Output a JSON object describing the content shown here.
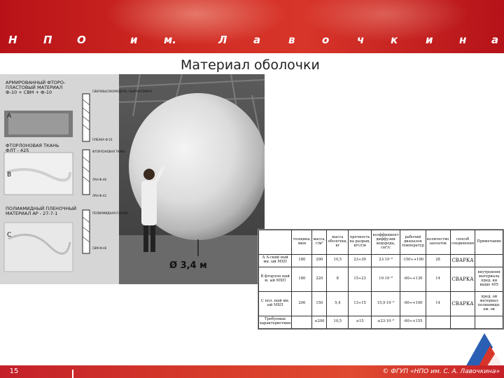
{
  "header": {
    "letters": [
      "Н",
      "П",
      "О",
      "и",
      "м.",
      "Л",
      "а",
      "в",
      "о",
      "ч",
      "к",
      "и",
      "н",
      "а"
    ],
    "background_color": "#cf2a22"
  },
  "title": "Материал оболочки",
  "photo": {
    "left_labels": {
      "material_a": "АРМИРОВАННЫЙ ФТОРО-\nПЛАСТОВЫЙ МАТЕРИАЛ\nФ-10 + СВМ + Ф-10",
      "letter_a": "А",
      "material_b": "ФТОРЛОНОВАЯ ТКАНЬ\nФЛТ - 425",
      "letter_b": "В",
      "material_c": "ПОЛИАМИДНЫЙ ПЛЕНОЧНЫЙ\nМАТЕРИАЛ АР - 27-7-1",
      "letter_c": "С"
    },
    "layer_labels": [
      "СВЕРХВЫСОКОМОДУЛЬ-\nНЫЙ МАТЕРИАЛ",
      "ПЛЕНКА Ф-10",
      "ФТОРЛОНОВАЯ\nТКАНЬ",
      "ЛАН Ф-46",
      "ЛАН Ф-42",
      "ПОЛИАМИДНАЯ\nПЛЕНКА",
      "СВМ Ф-46"
    ],
    "diameter_label": "Ø 3,4 м"
  },
  "table": {
    "headers": [
      "толщина, мкм",
      "масса, г/м²",
      "масса оболочки, кг",
      "прочность на разрыв, кгс/см",
      "коэффициент диффузии водорода, см²/с",
      "рабочий диапазон температур",
      "количество заплаток",
      "способ соединения",
      "Примечание"
    ],
    "rows": [
      {
        "label": "А\nА-ский ный мн. ый МХП",
        "values": [
          "180",
          "290",
          "10,5",
          "23÷30",
          "23·10⁻⁸",
          "-150÷+100",
          "28",
          "СВАРКА",
          ""
        ]
      },
      {
        "label": "В\nфторлон ный м. ый МХП",
        "values": [
          "180",
          "220",
          "8",
          "15÷23",
          "10·10⁻⁸",
          "-60÷+130",
          "14",
          "СВАРКА",
          "внутренняя материала пред. ки выше 405"
        ]
      },
      {
        "label": "С\nпол. ный мн. ый МХП",
        "values": [
          "200",
          "150",
          "5,4",
          "13÷15",
          "15,9·10⁻⁸",
          "-60÷+100",
          "14",
          "СВАРКА",
          "пред. ой материал полиамидн. ам. ок"
        ]
      },
      {
        "label": "Требуемые характеристики",
        "values": [
          "",
          "≤200",
          "10,5",
          "≥15",
          "≤23·10⁻⁸",
          "-60÷+155",
          "",
          "",
          ""
        ]
      }
    ]
  },
  "footer": {
    "page_number": "15",
    "copyright": "© ФГУП «НПО им. С. А. Лавочкина»",
    "color": "#d63a2a"
  },
  "logo": {
    "icon": "npo-lavochkin-logo-icon"
  }
}
